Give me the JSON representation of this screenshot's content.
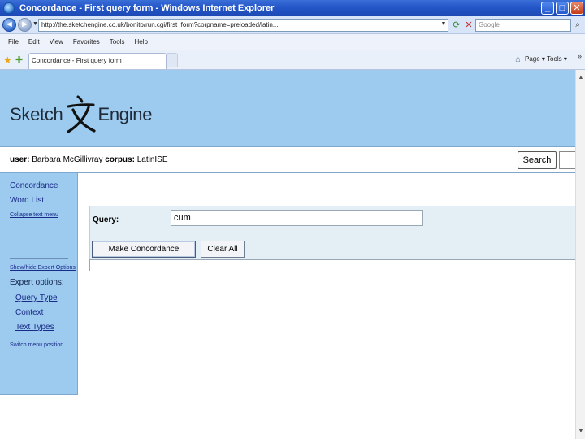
{
  "window": {
    "title": "Concordance - First query form - Windows Internet Explorer",
    "minimize": "_",
    "maximize": "□",
    "close": "✕"
  },
  "address_bar": {
    "url": "http://the.sketchengine.co.uk/bonito/run.cgi/first_form?corpname=preloaded/latin...",
    "search_placeholder": "Google"
  },
  "menu": {
    "items": [
      "File",
      "Edit",
      "View",
      "Favorites",
      "Tools",
      "Help"
    ]
  },
  "tabs": {
    "current": "Concordance - First query form",
    "page_menu": "Page ▾  Tools ▾",
    "more": "»"
  },
  "sketch": {
    "logo_left": "Sketch",
    "logo_right": "Engine",
    "user_label": "user:",
    "user_name": "Barbara McGillivray",
    "corpus_label": "corpus:",
    "corpus_name": "LatinISE",
    "search_button": "Search",
    "sidebar": {
      "concordance": "Concordance",
      "word_list": "Word List",
      "collapse_menu": "Collapse text menu",
      "show_expert": "Show/hide Expert Options",
      "expert_options": "Expert options:",
      "query_type": "Query Type",
      "context": "Context",
      "text_types": "Text Types",
      "switch_menu": "Switch menu position"
    },
    "form": {
      "query_label": "Query:",
      "query_value": "cum",
      "make_concordance": "Make Concordance",
      "clear_all": "Clear All"
    }
  },
  "colors": {
    "band": "#9ccbef",
    "panel": "#e3eff4",
    "titlebar": "#2456c8"
  }
}
